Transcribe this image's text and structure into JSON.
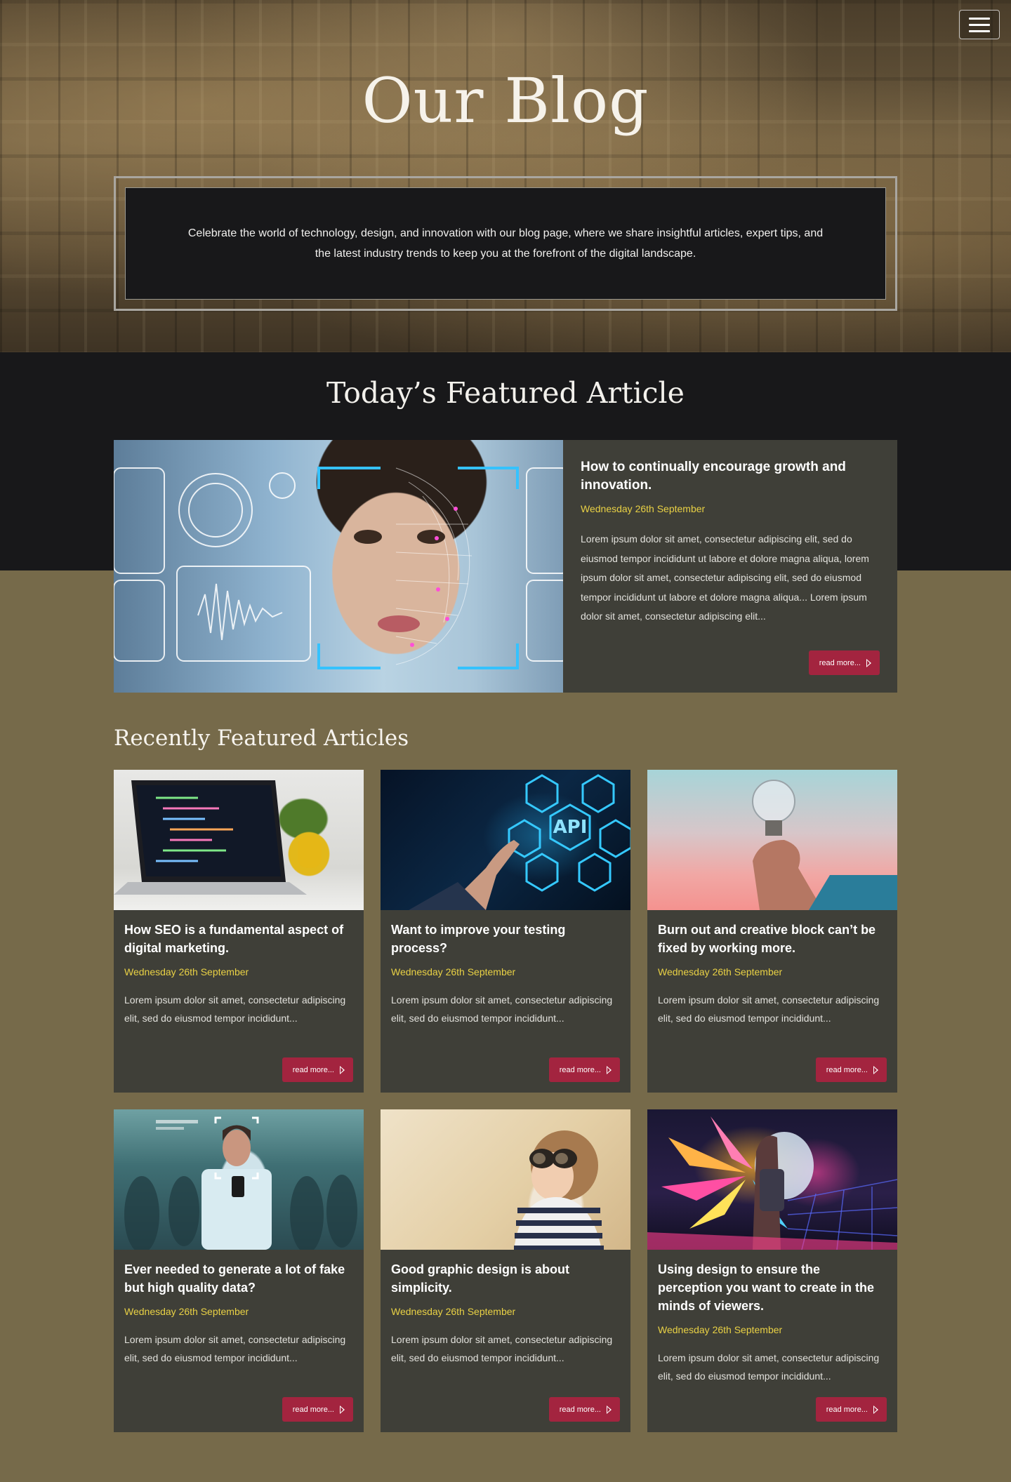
{
  "hero": {
    "title": "Our Blog",
    "intro": "Celebrate the world of technology, design, and innovation with our blog page, where we share insightful articles, expert tips, and the latest industry trends to keep you at the forefront of the digital landscape.",
    "menu_icon": "hamburger-menu-icon"
  },
  "featured": {
    "heading": "Today’s Featured Article",
    "article": {
      "title": "How to continually encourage growth and innovation.",
      "date": "Wednesday 26th September",
      "excerpt": "Lorem ipsum dolor sit amet, consectetur adipiscing elit, sed do eiusmod tempor incididunt ut labore et dolore magna aliqua, lorem ipsum dolor sit amet, consectetur adipiscing elit, sed do eiusmod tempor incididunt ut labore et dolore magna aliqua... Lorem ipsum dolor sit amet, consectetur adipiscing elit...",
      "read_more": "read more...",
      "image": "face-recognition-photo"
    }
  },
  "recent": {
    "heading": "Recently Featured Articles",
    "articles": [
      {
        "title": "How SEO is a fundamental aspect of digital marketing.",
        "date": "Wednesday 26th September",
        "excerpt": "Lorem ipsum dolor sit amet, consectetur adipiscing elit, sed do eiusmod tempor incididunt...",
        "read_more": "read more...",
        "image": "laptop-code-photo"
      },
      {
        "title": "Want to improve your testing process?",
        "date": "Wednesday 26th September",
        "excerpt": "Lorem ipsum dolor sit amet, consectetur adipiscing elit, sed do eiusmod tempor incididunt...",
        "read_more": "read more...",
        "image": "api-hologram-photo"
      },
      {
        "title": "Burn out and creative block can’t be fixed by working more.",
        "date": "Wednesday 26th September",
        "excerpt": "Lorem ipsum dolor sit amet, consectetur adipiscing elit, sed do eiusmod tempor incididunt...",
        "read_more": "read more...",
        "image": "light-bulb-photo"
      },
      {
        "title": "Ever needed to generate a lot of fake but high quality data?",
        "date": "Wednesday 26th September",
        "excerpt": "Lorem ipsum dolor sit amet, consectetur adipiscing elit, sed do eiusmod tempor incididunt...",
        "read_more": "read more...",
        "image": "crowd-face-scan-photo"
      },
      {
        "title": "Good graphic design is about simplicity.",
        "date": "Wednesday 26th September",
        "excerpt": "Lorem ipsum dolor sit amet, consectetur adipiscing elit, sed do eiusmod tempor incididunt...",
        "read_more": "read more...",
        "image": "child-binoculars-photo"
      },
      {
        "title": "Using design to ensure the perception you want to create in the minds of viewers.",
        "date": "Wednesday 26th September",
        "excerpt": "Lorem ipsum dolor sit amet, consectetur adipiscing elit, sed do eiusmod tempor incididunt...",
        "read_more": "read more...",
        "image": "neon-vr-photo"
      }
    ]
  },
  "colors": {
    "date_accent": "#e9d145",
    "button": "#a3243f",
    "card_bg": "#3f3f38",
    "page_bg": "#766a4a",
    "dark_band": "#18181a"
  }
}
